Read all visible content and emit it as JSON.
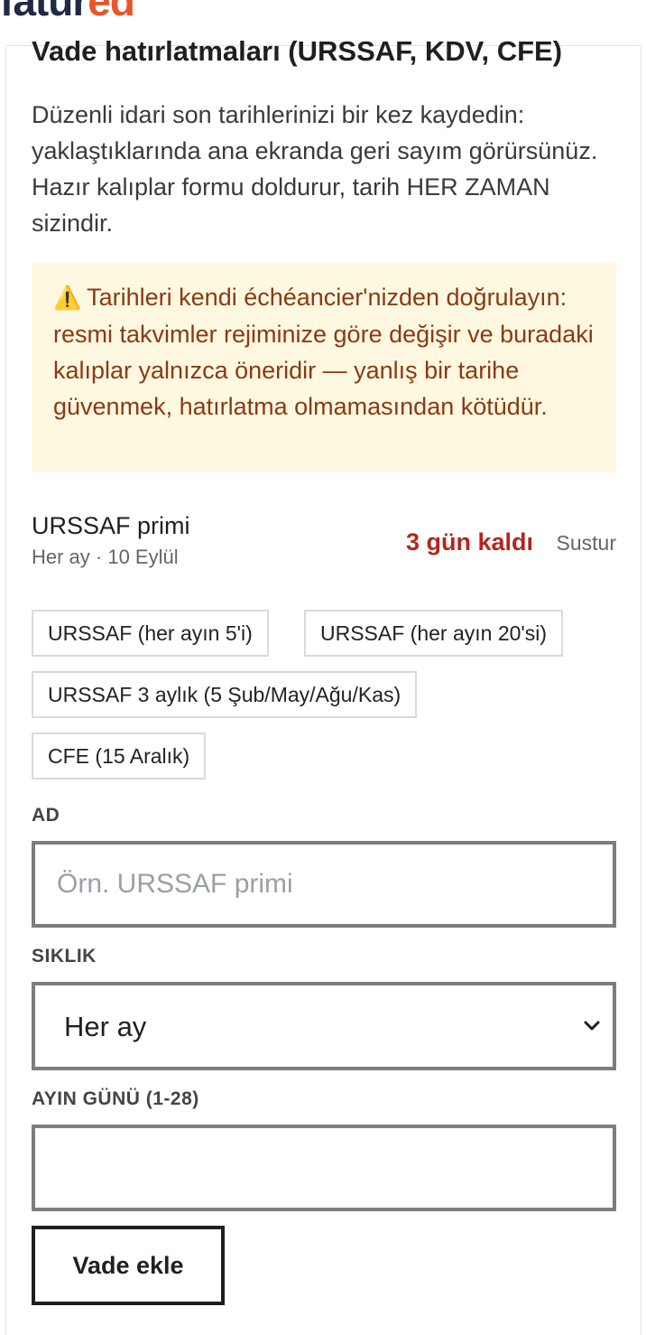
{
  "brand": {
    "part1": "fatur",
    "part2": "ed"
  },
  "section": {
    "title": "Vade hatırlatmaları (URSSAF, KDV, CFE)",
    "intro": "Düzenli idari son tarihlerinizi bir kez kaydedin: yaklaştıklarında ana ekranda geri sayım görürsünüz. Hazır kalıplar formu doldurur, tarih HER ZAMAN sizindir."
  },
  "warning": {
    "icon": "⚠️",
    "text": "Tarihleri kendi échéancier'nizden doğrulayın: resmi takvimler rejiminize göre değişir ve buradaki kalıplar yalnızca öneridir — yanlış bir tarihe güvenmek, hatırlatma olmamasından kötüdür."
  },
  "reminder": {
    "name": "URSSAF primi",
    "schedule": "Her ay · 10 Eylül",
    "countdown": "3 gün kaldı",
    "mute_label": "Sustur"
  },
  "presets": [
    "URSSAF (her ayın 5'i)",
    "URSSAF (her ayın 20'si)",
    "URSSAF 3 aylık (5 Şub/May/Ağu/Kas)",
    "CFE (15 Aralık)"
  ],
  "form": {
    "name_label": "AD",
    "name_placeholder": "Örn. URSSAF primi",
    "name_value": "",
    "frequency_label": "SIKLIK",
    "frequency_value": "Her ay",
    "day_label": "AYIN GÜNÜ (1-28)",
    "day_value": "",
    "submit_label": "Vade ekle"
  },
  "icons": {
    "warning": "warning-icon",
    "chevron": "chevron-down-icon"
  },
  "colors": {
    "brand_dark": "#1f2a44",
    "brand_accent": "#e8542b",
    "countdown": "#b3261e",
    "warning_bg": "#fff8e1",
    "warning_text": "#8a3a12"
  }
}
